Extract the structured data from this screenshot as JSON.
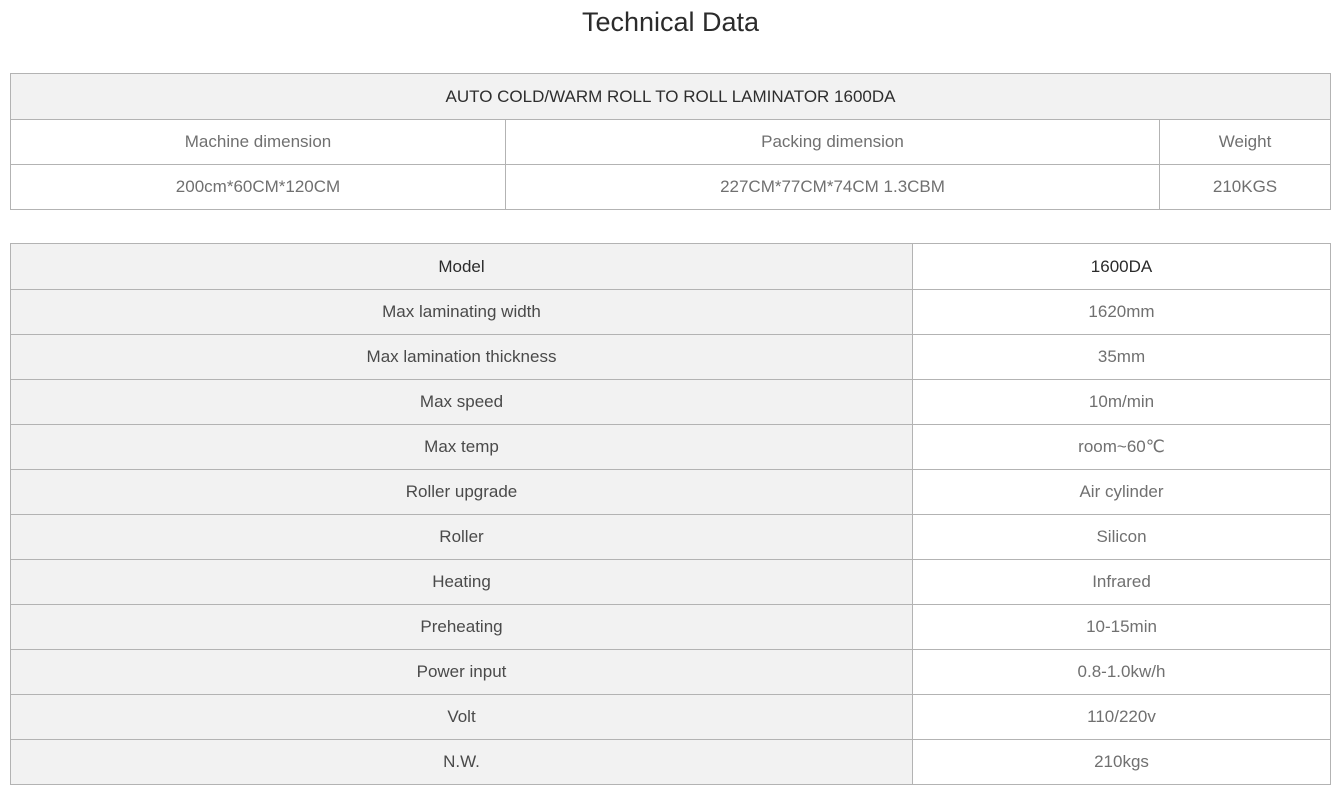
{
  "page_title": "Technical Data",
  "dimensions_table": {
    "title": "AUTO COLD/WARM ROLL TO ROLL LAMINATOR 1600DA",
    "headers": [
      "Machine dimension",
      "Packing dimension",
      "Weight"
    ],
    "values": [
      "200cm*60CM*120CM",
      "227CM*77CM*74CM 1.3CBM",
      "210KGS"
    ]
  },
  "spec_table": {
    "header": {
      "label": "Model",
      "value": "1600DA"
    },
    "rows": [
      {
        "label": "Max laminating width",
        "value": "1620mm"
      },
      {
        "label": "Max lamination thickness",
        "value": "35mm"
      },
      {
        "label": "Max speed",
        "value": "10m/min"
      },
      {
        "label": "Max temp",
        "value": "room~60℃"
      },
      {
        "label": "Roller upgrade",
        "value": "Air cylinder"
      },
      {
        "label": "Roller",
        "value": "Silicon"
      },
      {
        "label": "Heating",
        "value": "Infrared"
      },
      {
        "label": "Preheating",
        "value": "10-15min"
      },
      {
        "label": "Power input",
        "value": "0.8-1.0kw/h"
      },
      {
        "label": "Volt",
        "value": "110/220v"
      },
      {
        "label": "N.W.",
        "value": "210kgs"
      }
    ]
  }
}
